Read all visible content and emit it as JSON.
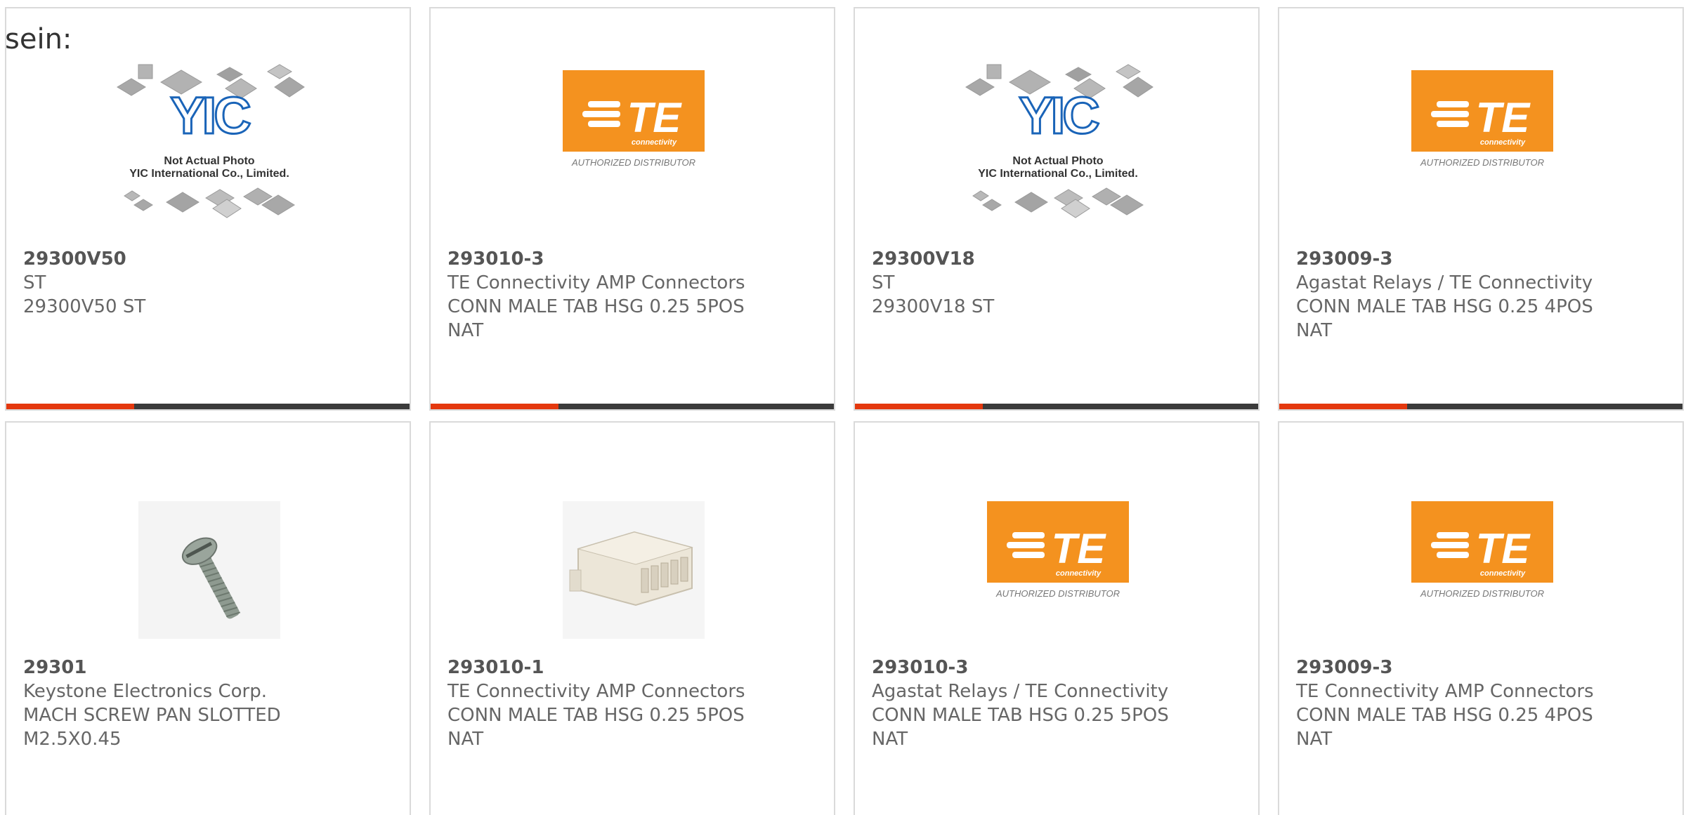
{
  "intro_text": "sein:",
  "colors": {
    "te_orange": "#f4921f",
    "yic_blue": "#1a64b8",
    "accent_red": "#e4380e",
    "bar_dark": "#3b3b3b",
    "text_gray": "#666666"
  },
  "yic_logo": {
    "mark": "YIC",
    "caption_1": "Not Actual Photo",
    "caption_2": "YIC International Co., Limited."
  },
  "te_logo": {
    "mark": "TE",
    "sub": "connectivity",
    "caption": "AUTHORIZED DISTRIBUTOR"
  },
  "products": [
    {
      "image": "yic-placeholder",
      "part_number": "29300V50",
      "manufacturer": "ST",
      "description": [
        "29300V50 ST"
      ]
    },
    {
      "image": "te-logo",
      "part_number": "293010-3",
      "manufacturer": "TE Connectivity AMP Connectors",
      "description": [
        "CONN MALE TAB HSG 0.25 5POS",
        "NAT"
      ]
    },
    {
      "image": "yic-placeholder",
      "part_number": "29300V18",
      "manufacturer": "ST",
      "description": [
        "29300V18 ST"
      ]
    },
    {
      "image": "te-logo",
      "part_number": "293009-3",
      "manufacturer": "Agastat Relays / TE Connectivity",
      "description": [
        "CONN MALE TAB HSG 0.25 4POS",
        "NAT"
      ]
    },
    {
      "image": "screw-photo",
      "part_number": "29301",
      "manufacturer": "Keystone Electronics Corp.",
      "description": [
        "MACH SCREW PAN SLOTTED",
        "M2.5X0.45"
      ]
    },
    {
      "image": "connector-photo",
      "part_number": "293010-1",
      "manufacturer": "TE Connectivity AMP Connectors",
      "description": [
        "CONN MALE TAB HSG 0.25 5POS",
        "NAT"
      ]
    },
    {
      "image": "te-logo",
      "part_number": "293010-3",
      "manufacturer": "Agastat Relays / TE Connectivity",
      "description": [
        "CONN MALE TAB HSG 0.25 5POS",
        "NAT"
      ]
    },
    {
      "image": "te-logo",
      "part_number": "293009-3",
      "manufacturer": "TE Connectivity AMP Connectors",
      "description": [
        "CONN MALE TAB HSG 0.25 4POS",
        "NAT"
      ]
    }
  ]
}
